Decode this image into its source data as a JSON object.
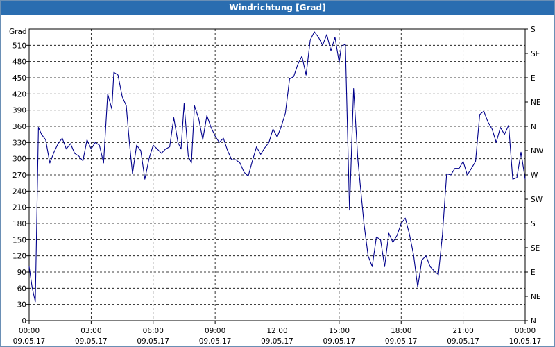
{
  "window": {
    "title": "Windrichtung [Grad]"
  },
  "chart_data": {
    "type": "line",
    "title": "Windrichtung [Grad]",
    "ylabel": "Grad",
    "ylim": [
      0,
      540
    ],
    "yticks": [
      0,
      30,
      60,
      90,
      120,
      150,
      180,
      210,
      240,
      270,
      300,
      330,
      360,
      390,
      420,
      450,
      480,
      510
    ],
    "right_labels": [
      "N",
      "NE",
      "E",
      "SE",
      "S",
      "SW",
      "W",
      "NW",
      "N",
      "NE",
      "E",
      "SE",
      "S"
    ],
    "xticks": [
      {
        "time": "00:00",
        "date": "09.05.17"
      },
      {
        "time": "03:00",
        "date": "09.05.17"
      },
      {
        "time": "06:00",
        "date": "09.05.17"
      },
      {
        "time": "09:00",
        "date": "09.05.17"
      },
      {
        "time": "12:00",
        "date": "09.05.17"
      },
      {
        "time": "15:00",
        "date": "09.05.17"
      },
      {
        "time": "18:00",
        "date": "09.05.17"
      },
      {
        "time": "21:00",
        "date": "09.05.17"
      },
      {
        "time": "00:00",
        "date": "10.05.17"
      }
    ],
    "xrange_hours": [
      0,
      24
    ],
    "grid": true,
    "line_color": "#00008b",
    "series": [
      {
        "hours": [
          0.0,
          0.15,
          0.3,
          0.45,
          0.6,
          0.8,
          1.0,
          1.2,
          1.4,
          1.6,
          1.8,
          2.0,
          2.2,
          2.4,
          2.6,
          2.8,
          3.0,
          3.2,
          3.4,
          3.6,
          3.8,
          4.0,
          4.1,
          4.3,
          4.5,
          4.7,
          4.85,
          5.0,
          5.2,
          5.4,
          5.6,
          5.8,
          6.0,
          6.2,
          6.4,
          6.6,
          6.8,
          7.0,
          7.2,
          7.35,
          7.5,
          7.7,
          7.85,
          8.0,
          8.2,
          8.4,
          8.6,
          8.8,
          9.0,
          9.2,
          9.4,
          9.6,
          9.8,
          10.0,
          10.2,
          10.4,
          10.6,
          10.8,
          11.0,
          11.2,
          11.4,
          11.6,
          11.8,
          12.0,
          12.2,
          12.4,
          12.6,
          12.8,
          13.0,
          13.2,
          13.4,
          13.6,
          13.8,
          14.0,
          14.2,
          14.4,
          14.6,
          14.8,
          15.0,
          15.1,
          15.3,
          15.5,
          15.7,
          15.9,
          16.2,
          16.4,
          16.6,
          16.8,
          17.0,
          17.2,
          17.4,
          17.6,
          17.8,
          18.0,
          18.2,
          18.4,
          18.6,
          18.8,
          19.0,
          19.2,
          19.4,
          19.6,
          19.8,
          20.0,
          20.2,
          20.4,
          20.6,
          20.8,
          21.0,
          21.2,
          21.4,
          21.6,
          21.8,
          22.0,
          22.2,
          22.4,
          22.6,
          22.8,
          23.0,
          23.2,
          23.4,
          23.6,
          23.8,
          24.0
        ],
        "values": [
          100,
          60,
          35,
          358,
          345,
          335,
          292,
          312,
          328,
          338,
          318,
          328,
          310,
          305,
          296,
          335,
          318,
          330,
          325,
          292,
          420,
          392,
          460,
          455,
          415,
          398,
          330,
          272,
          325,
          315,
          262,
          300,
          325,
          318,
          310,
          318,
          322,
          376,
          330,
          318,
          402,
          305,
          292,
          398,
          375,
          335,
          380,
          358,
          342,
          330,
          338,
          315,
          298,
          298,
          292,
          275,
          268,
          296,
          322,
          308,
          320,
          330,
          355,
          340,
          360,
          385,
          448,
          452,
          475,
          490,
          455,
          520,
          535,
          525,
          510,
          530,
          500,
          525,
          478,
          508,
          512,
          205,
          430,
          300,
          180,
          120,
          100,
          155,
          150,
          100,
          162,
          145,
          158,
          180,
          190,
          160,
          122,
          62,
          112,
          120,
          100,
          92,
          85,
          160,
          272,
          270,
          282,
          282,
          295,
          270,
          282,
          295,
          382,
          388,
          368,
          355,
          330,
          358,
          345,
          362,
          262,
          265,
          312,
          262,
          300
        ]
      }
    ]
  }
}
